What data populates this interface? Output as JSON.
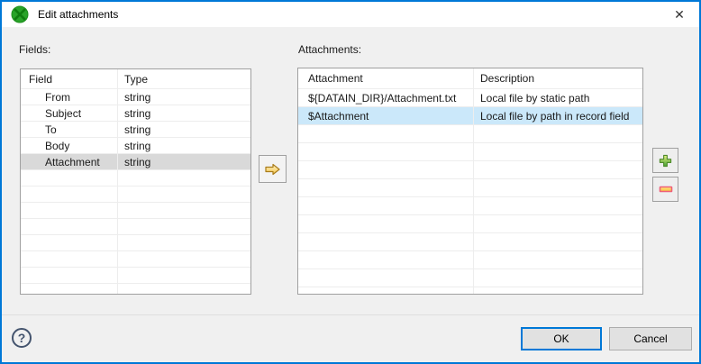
{
  "window": {
    "title": "Edit attachments",
    "close_glyph": "✕"
  },
  "fields_panel": {
    "label": "Fields:",
    "columns": [
      "Field",
      "Type"
    ],
    "rows": [
      {
        "field": "From",
        "type": "string"
      },
      {
        "field": "Subject",
        "type": "string"
      },
      {
        "field": "To",
        "type": "string"
      },
      {
        "field": "Body",
        "type": "string"
      },
      {
        "field": "Attachment",
        "type": "string"
      }
    ],
    "selected_row": "Attachment"
  },
  "attachments_panel": {
    "label": "Attachments:",
    "columns": [
      "Attachment",
      "Description"
    ],
    "rows": [
      {
        "attachment": "${DATAIN_DIR}/Attachment.txt",
        "description": "Local file by static path"
      },
      {
        "attachment": "$Attachment",
        "description": "Local file by path in record field"
      }
    ],
    "selected_row": "$Attachment"
  },
  "footer": {
    "help_glyph": "?",
    "ok_label": "OK",
    "cancel_label": "Cancel"
  },
  "colors": {
    "accent": "#0078d7",
    "selection_active": "#cbe8fa",
    "selection_inactive": "#d9d9d9",
    "dialog_bg": "#f0f0f0",
    "titlebar_bg": "#ffffff"
  }
}
